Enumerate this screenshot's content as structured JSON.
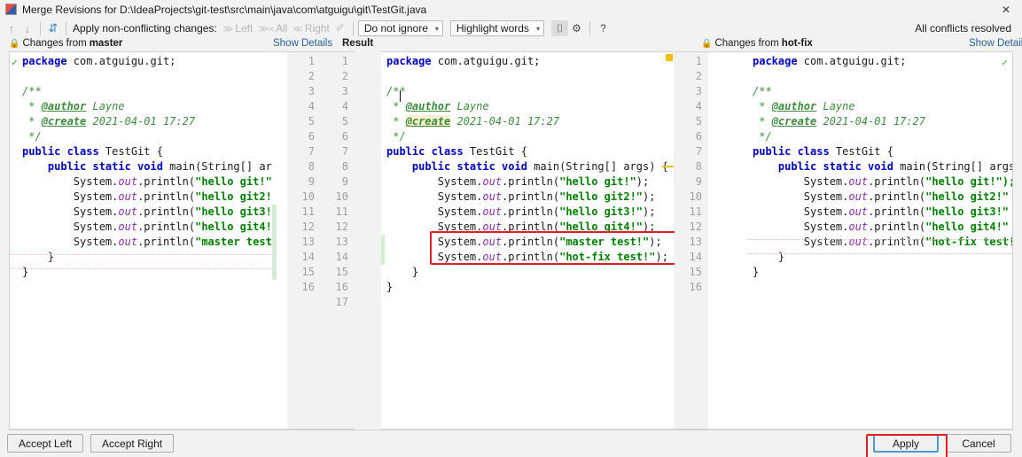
{
  "window": {
    "title": "Merge Revisions for D:\\IdeaProjects\\git-test\\src\\main\\java\\com\\atguigu\\git\\TestGit.java",
    "close_label": "✕",
    "app_icon": "intellij-idea-icon"
  },
  "toolbar": {
    "prev_label": "↑",
    "next_label": "↓",
    "magic_label": "⇵",
    "apply_changes_label": "Apply non-conflicting changes:",
    "left_label": "Left",
    "all_label": "All",
    "right_label": "Right",
    "wand_label": "✐",
    "ignore_policy": "Do not ignore",
    "highlight_policy": "Highlight words",
    "collapse_label": "⌷",
    "settings_label": "⚙",
    "help_label": "?",
    "status": "All conflicts resolved",
    "chev_left": "≫",
    "chev_all": "≫«",
    "chev_right": "≪",
    "caret": "▾"
  },
  "panes": {
    "left": {
      "header_prefix": "Changes from",
      "header_branch": "master",
      "lock_icon": "lock-icon",
      "ok_icon": "check-icon"
    },
    "result": {
      "show_details": "Show Details",
      "title": "Result"
    },
    "right": {
      "header_prefix": "Changes from",
      "header_branch": "hot-fix",
      "show_details": "Show Details",
      "lock_icon": "lock-icon",
      "ok_icon": "check-icon"
    }
  },
  "code": {
    "left_lines": [
      [
        {
          "t": "package ",
          "c": "kw"
        },
        {
          "t": "com.atguigu.git;",
          "c": "pln"
        }
      ],
      [],
      [
        {
          "t": "/**",
          "c": "cmt"
        }
      ],
      [
        {
          "t": " * ",
          "c": "cmt"
        },
        {
          "t": "@author",
          "c": "tag"
        },
        {
          "t": " Layne",
          "c": "cmt"
        }
      ],
      [
        {
          "t": " * ",
          "c": "cmt"
        },
        {
          "t": "@create",
          "c": "tag"
        },
        {
          "t": " 2021-04-01 17:27",
          "c": "cmt"
        }
      ],
      [
        {
          "t": " */",
          "c": "cmt"
        }
      ],
      [
        {
          "t": "public class ",
          "c": "kw"
        },
        {
          "t": "TestGit {",
          "c": "pln"
        }
      ],
      [
        {
          "t": "    public static void ",
          "c": "kw"
        },
        {
          "t": "main(String[] arg",
          "c": "pln"
        }
      ],
      [
        {
          "t": "        System.",
          "c": "pln"
        },
        {
          "t": "out",
          "c": "fld"
        },
        {
          "t": ".println(",
          "c": "pln"
        },
        {
          "t": "\"hello git!\")",
          "c": "str"
        }
      ],
      [
        {
          "t": "        System.",
          "c": "pln"
        },
        {
          "t": "out",
          "c": "fld"
        },
        {
          "t": ".println(",
          "c": "pln"
        },
        {
          "t": "\"hello git2!\"",
          "c": "str"
        }
      ],
      [
        {
          "t": "        System.",
          "c": "pln"
        },
        {
          "t": "out",
          "c": "fld"
        },
        {
          "t": ".println(",
          "c": "pln"
        },
        {
          "t": "\"hello git3!\"",
          "c": "str"
        }
      ],
      [
        {
          "t": "        System.",
          "c": "pln"
        },
        {
          "t": "out",
          "c": "fld"
        },
        {
          "t": ".println(",
          "c": "pln"
        },
        {
          "t": "\"hello git4!\"",
          "c": "str"
        }
      ],
      [
        {
          "t": "        System.",
          "c": "pln"
        },
        {
          "t": "out",
          "c": "fld"
        },
        {
          "t": ".println(",
          "c": "pln"
        },
        {
          "t": "\"master test!",
          "c": "str"
        }
      ],
      [
        {
          "t": "    }",
          "c": "pln"
        }
      ],
      [
        {
          "t": "}",
          "c": "pln"
        }
      ]
    ],
    "result_lines": [
      [
        {
          "t": "package ",
          "c": "kw"
        },
        {
          "t": "com.atguigu.git;",
          "c": "pln"
        }
      ],
      [],
      [
        {
          "t": "/**",
          "c": "cmt"
        }
      ],
      [
        {
          "t": " * ",
          "c": "cmt"
        },
        {
          "t": "@author",
          "c": "tag"
        },
        {
          "t": " Layne",
          "c": "cmt"
        }
      ],
      [
        {
          "t": " * ",
          "c": "cmt"
        },
        {
          "t": "@create",
          "c": "tag",
          "h": true
        },
        {
          "t": " 2021-04-01 17:27",
          "c": "cmt"
        }
      ],
      [
        {
          "t": " */",
          "c": "cmt"
        }
      ],
      [
        {
          "t": "public class ",
          "c": "kw"
        },
        {
          "t": "TestGit {",
          "c": "pln"
        }
      ],
      [
        {
          "t": "    public static void ",
          "c": "kw"
        },
        {
          "t": "main(String[] args) {",
          "c": "pln"
        }
      ],
      [
        {
          "t": "        System.",
          "c": "pln"
        },
        {
          "t": "out",
          "c": "fld"
        },
        {
          "t": ".println(",
          "c": "pln"
        },
        {
          "t": "\"hello git!\"",
          "c": "str"
        },
        {
          "t": ");",
          "c": "pln"
        }
      ],
      [
        {
          "t": "        System.",
          "c": "pln"
        },
        {
          "t": "out",
          "c": "fld"
        },
        {
          "t": ".println(",
          "c": "pln"
        },
        {
          "t": "\"hello git2!\"",
          "c": "str"
        },
        {
          "t": ");",
          "c": "pln"
        }
      ],
      [
        {
          "t": "        System.",
          "c": "pln"
        },
        {
          "t": "out",
          "c": "fld"
        },
        {
          "t": ".println(",
          "c": "pln"
        },
        {
          "t": "\"hello git3!\"",
          "c": "str"
        },
        {
          "t": ");",
          "c": "pln"
        }
      ],
      [
        {
          "t": "        System.",
          "c": "pln"
        },
        {
          "t": "out",
          "c": "fld"
        },
        {
          "t": ".println(",
          "c": "pln"
        },
        {
          "t": "\"hello git4!\"",
          "c": "str"
        },
        {
          "t": ");",
          "c": "pln"
        }
      ],
      [
        {
          "t": "        System.",
          "c": "pln"
        },
        {
          "t": "out",
          "c": "fld"
        },
        {
          "t": ".println(",
          "c": "pln"
        },
        {
          "t": "\"master test!\"",
          "c": "str"
        },
        {
          "t": ");",
          "c": "pln"
        }
      ],
      [
        {
          "t": "        System.",
          "c": "pln"
        },
        {
          "t": "out",
          "c": "fld"
        },
        {
          "t": ".println(",
          "c": "pln"
        },
        {
          "t": "\"hot-fix test!\"",
          "c": "str"
        },
        {
          "t": ");",
          "c": "pln"
        }
      ],
      [
        {
          "t": "    }",
          "c": "pln"
        }
      ],
      [
        {
          "t": "}",
          "c": "pln"
        }
      ]
    ],
    "right_lines": [
      [
        {
          "t": "package ",
          "c": "kw"
        },
        {
          "t": "com.atguigu.git;",
          "c": "pln"
        }
      ],
      [],
      [
        {
          "t": "/**",
          "c": "cmt"
        }
      ],
      [
        {
          "t": " * ",
          "c": "cmt"
        },
        {
          "t": "@author",
          "c": "tag"
        },
        {
          "t": " Layne",
          "c": "cmt"
        }
      ],
      [
        {
          "t": " * ",
          "c": "cmt"
        },
        {
          "t": "@create",
          "c": "tag"
        },
        {
          "t": " 2021-04-01 17:27",
          "c": "cmt"
        }
      ],
      [
        {
          "t": " */",
          "c": "cmt"
        }
      ],
      [
        {
          "t": "public class ",
          "c": "kw"
        },
        {
          "t": "TestGit {",
          "c": "pln"
        }
      ],
      [
        {
          "t": "    public static void ",
          "c": "kw"
        },
        {
          "t": "main(String[] args",
          "c": "pln"
        }
      ],
      [
        {
          "t": "        System.",
          "c": "pln"
        },
        {
          "t": "out",
          "c": "fld"
        },
        {
          "t": ".println(",
          "c": "pln"
        },
        {
          "t": "\"hello git!\");",
          "c": "str"
        }
      ],
      [
        {
          "t": "        System.",
          "c": "pln"
        },
        {
          "t": "out",
          "c": "fld"
        },
        {
          "t": ".println(",
          "c": "pln"
        },
        {
          "t": "\"hello git2!\"",
          "c": "str"
        }
      ],
      [
        {
          "t": "        System.",
          "c": "pln"
        },
        {
          "t": "out",
          "c": "fld"
        },
        {
          "t": ".println(",
          "c": "pln"
        },
        {
          "t": "\"hello git3!\"",
          "c": "str"
        }
      ],
      [
        {
          "t": "        System.",
          "c": "pln"
        },
        {
          "t": "out",
          "c": "fld"
        },
        {
          "t": ".println(",
          "c": "pln"
        },
        {
          "t": "\"hello git4!\"",
          "c": "str"
        }
      ],
      [
        {
          "t": "        System.",
          "c": "pln"
        },
        {
          "t": "out",
          "c": "fld"
        },
        {
          "t": ".println(",
          "c": "pln"
        },
        {
          "t": "\"hot-fix test!",
          "c": "str"
        }
      ],
      [
        {
          "t": "    }",
          "c": "pln"
        }
      ],
      [
        {
          "t": "}",
          "c": "pln"
        }
      ]
    ],
    "gutter_a": [
      "1",
      "2",
      "3",
      "4",
      "5",
      "6",
      "7",
      "8",
      "9",
      "10",
      "11",
      "12",
      "13",
      "14",
      "15",
      "16",
      ""
    ],
    "gutter_b": [
      "1",
      "2",
      "3",
      "4",
      "5",
      "6",
      "7",
      "8",
      "9",
      "10",
      "11",
      "12",
      "13",
      "14",
      "15",
      "16",
      "17"
    ],
    "gutter_right": [
      "1",
      "2",
      "3",
      "4",
      "5",
      "6",
      "7",
      "8",
      "9",
      "10",
      "11",
      "12",
      "13",
      "14",
      "15",
      "16"
    ]
  },
  "annotations": {
    "merged_lines_box": "red-highlight-box",
    "apply_button_box": "red-highlight-box"
  },
  "footer": {
    "accept_left": "Accept Left",
    "accept_right": "Accept Right",
    "apply": "Apply",
    "cancel": "Cancel"
  },
  "colors": {
    "accent_blue": "#2a6099",
    "annotation_red": "#e02020",
    "ok_green": "#3c9a3c",
    "marker_yellow": "#f0c000",
    "string_green": "#008000",
    "keyword_blue": "#0000c0"
  }
}
